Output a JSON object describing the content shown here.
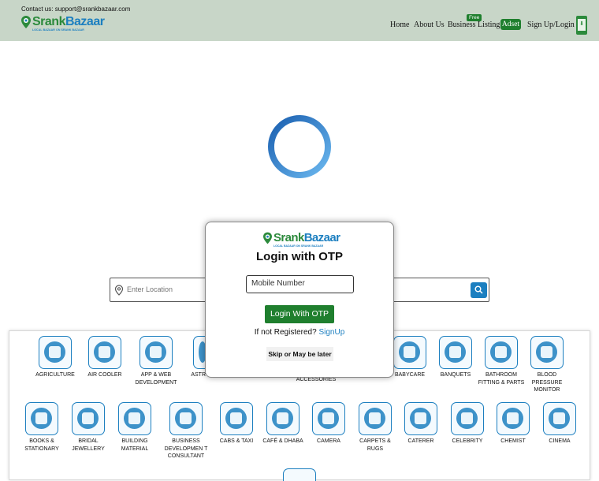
{
  "header": {
    "contact": "Contact us: support@srankbazaar.com",
    "logo_part1": "Srank",
    "logo_part2": "Bazaar",
    "logo_tagline": "LOCAL BAZAAR ON SRANK BAZAAR",
    "nav": {
      "home": "Home",
      "about": "About Us",
      "business": "Business Listing",
      "free_badge": "Free",
      "adset": "Adset",
      "signup": "Sign Up/Login"
    },
    "app_icon": "download-app-icon"
  },
  "loader": {
    "icon": "loading-spinner"
  },
  "search": {
    "location_placeholder": "Enter Location",
    "location_icon": "map-pin-icon",
    "search_icon": "search-icon"
  },
  "categories": {
    "row1": [
      "AGRICULTURE",
      "AIR COOLER",
      "APP & WEB DEVELOPMENT",
      "ASTR",
      "ACCESSORIES",
      "BABYCARE",
      "BANQUETS",
      "BATHROOM FITTING & PARTS",
      "BLOOD PRESSURE MONITOR"
    ],
    "row2": [
      "BOOKS & STATIONARY",
      "BRIDAL JEWELLERY",
      "BUILDING MATERIAL",
      "BUSINESS DEVELOPMEN T CONSULTANT",
      "CABS & TAXI",
      "CAFÉ & DHABA",
      "CAMERA",
      "CARPETS & RUGS",
      "CATERER",
      "CELEBRITY",
      "CHEMIST",
      "CINEMA"
    ]
  },
  "modal": {
    "logo_part1": "Srank",
    "logo_part2": "Bazaar",
    "logo_tagline": "LOCAL BAZAAR ON SRANK BAZAAR",
    "title": "Login with OTP",
    "mobile_placeholder": "Mobile Number",
    "otp_button": "Login With OTP",
    "not_registered": "If not Registered?",
    "signup_link": "SignUp",
    "skip": "Skip or May be later"
  },
  "colors": {
    "header_bg": "#c8d6c8",
    "green": "#1f7f2e",
    "blue": "#1c7fc0"
  }
}
